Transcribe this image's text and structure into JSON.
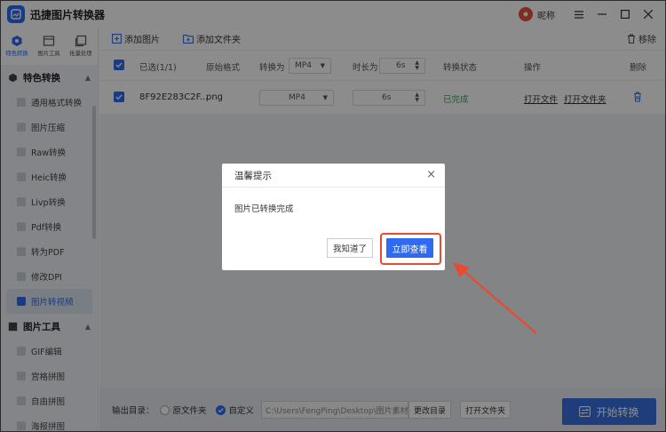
{
  "app": {
    "title": "迅捷图片转换器",
    "nickname": "昵称"
  },
  "sidebar": {
    "tabs": [
      {
        "label": "特色转换"
      },
      {
        "label": "图片工具"
      },
      {
        "label": "批量处理"
      }
    ],
    "group1": {
      "label": "特色转换",
      "items": [
        {
          "label": "通用格式转换"
        },
        {
          "label": "图片压缩"
        },
        {
          "label": "Raw转换"
        },
        {
          "label": "Heic转换"
        },
        {
          "label": "Livp转换"
        },
        {
          "label": "Pdf转换"
        },
        {
          "label": "转为PDF"
        },
        {
          "label": "修改DPI"
        },
        {
          "label": "图片转视频"
        }
      ]
    },
    "group2": {
      "label": "图片工具",
      "items": [
        {
          "label": "GIF编辑"
        },
        {
          "label": "宫格拼图"
        },
        {
          "label": "自由拼图"
        },
        {
          "label": "海报拼图"
        }
      ]
    }
  },
  "toolbar": {
    "add_image": "添加图片",
    "add_folder": "添加文件夹",
    "remove": "移除"
  },
  "table": {
    "headers": {
      "selected": "已选(1/1)",
      "format": "原始格式",
      "convert_to": "转换为",
      "convert_value": "MP4",
      "duration": "时长为",
      "duration_value": "6s",
      "status": "转换状态",
      "action": "操作",
      "delete": "删除"
    },
    "rows": [
      {
        "name": "8F92E283C2F...",
        "format": "png",
        "convert": "MP4",
        "duration": "6s",
        "status": "已完成",
        "open_file": "打开文件",
        "open_folder": "打开文件夹"
      }
    ]
  },
  "bottom": {
    "output_label": "输出目录：",
    "opt_original": "原文件夹",
    "opt_custom": "自定义",
    "path": "C:\\Users\\FengPing\\Desktop\\图片素材",
    "change_dir": "更改目录",
    "open_folder": "打开文件夹",
    "start": "开始转换"
  },
  "dialog": {
    "title": "温馨提示",
    "message": "图片已转换完成",
    "btn_ok": "我知道了",
    "btn_view": "立即查看"
  },
  "colors": {
    "accent": "#2f6bf0",
    "success": "#37a353",
    "annotation": "#e84a32"
  }
}
